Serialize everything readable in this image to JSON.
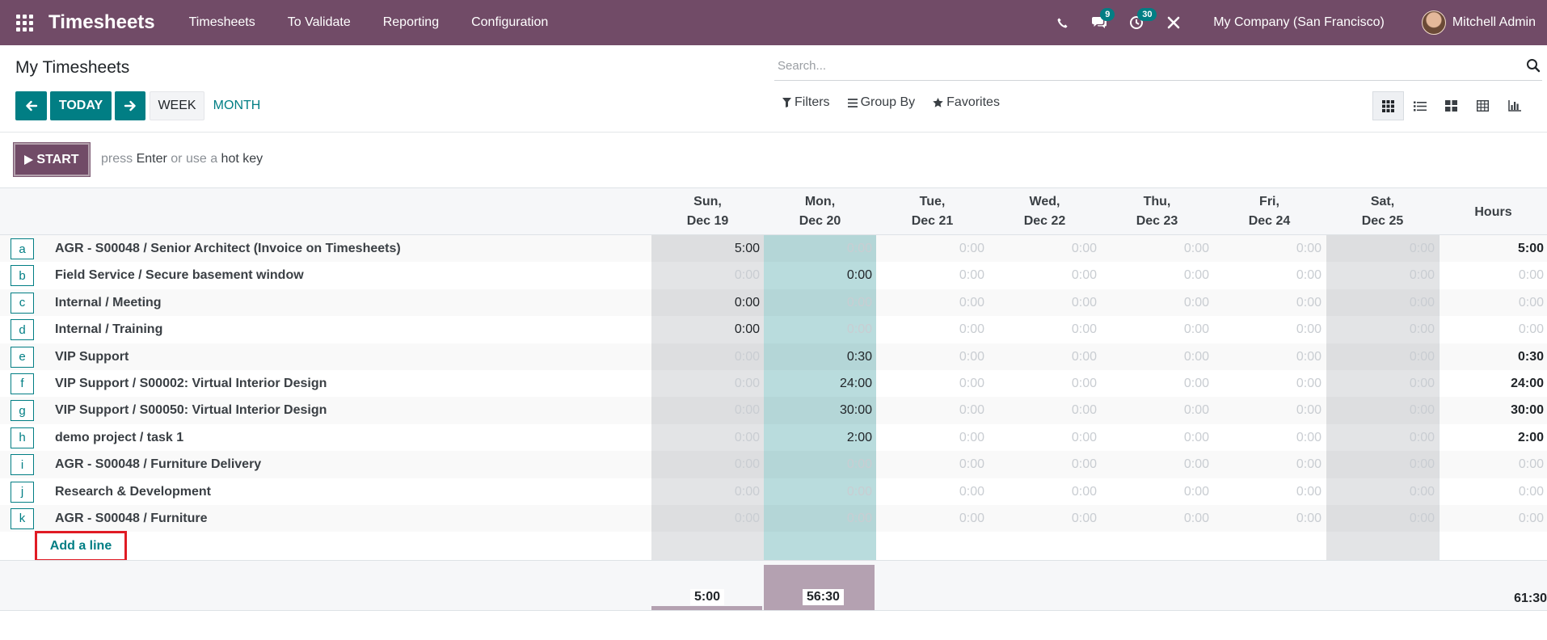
{
  "navbar": {
    "app_name": "Timesheets",
    "menu": [
      "Timesheets",
      "To Validate",
      "Reporting",
      "Configuration"
    ],
    "messages_count": "9",
    "activities_count": "30",
    "company": "My Company (San Francisco)",
    "user": "Mitchell Admin"
  },
  "page": {
    "title": "My Timesheets",
    "search_placeholder": "Search...",
    "today_label": "TODAY",
    "week_label": "WEEK",
    "month_label": "MONTH",
    "filters_label": "Filters",
    "group_by_label": "Group By",
    "favorites_label": "Favorites",
    "start_label": "START",
    "hint_press": "press",
    "hint_enter": "Enter",
    "hint_or": "or use a",
    "hint_hotkey": "hot key"
  },
  "grid": {
    "days": [
      {
        "day": "Sun,",
        "date": "Dec 19"
      },
      {
        "day": "Mon,",
        "date": "Dec 20"
      },
      {
        "day": "Tue,",
        "date": "Dec 21"
      },
      {
        "day": "Wed,",
        "date": "Dec 22"
      },
      {
        "day": "Thu,",
        "date": "Dec 23"
      },
      {
        "day": "Fri,",
        "date": "Dec 24"
      },
      {
        "day": "Sat,",
        "date": "Dec 25"
      }
    ],
    "hours_header": "Hours",
    "rows": [
      {
        "key": "a",
        "name": "AGR - S00048  /  Senior Architect (Invoice on Timesheets)",
        "values": [
          "5:00",
          "0:00",
          "0:00",
          "0:00",
          "0:00",
          "0:00",
          "0:00"
        ],
        "filled": [
          true,
          false,
          false,
          false,
          false,
          false,
          false
        ],
        "total": "5:00"
      },
      {
        "key": "b",
        "name": "Field Service  /  Secure basement window",
        "values": [
          "0:00",
          "0:00",
          "0:00",
          "0:00",
          "0:00",
          "0:00",
          "0:00"
        ],
        "filled": [
          false,
          true,
          false,
          false,
          false,
          false,
          false
        ],
        "total": "0:00"
      },
      {
        "key": "c",
        "name": "Internal  /  Meeting",
        "values": [
          "0:00",
          "0:00",
          "0:00",
          "0:00",
          "0:00",
          "0:00",
          "0:00"
        ],
        "filled": [
          true,
          false,
          false,
          false,
          false,
          false,
          false
        ],
        "total": "0:00"
      },
      {
        "key": "d",
        "name": "Internal  /  Training",
        "values": [
          "0:00",
          "0:00",
          "0:00",
          "0:00",
          "0:00",
          "0:00",
          "0:00"
        ],
        "filled": [
          true,
          false,
          false,
          false,
          false,
          false,
          false
        ],
        "total": "0:00"
      },
      {
        "key": "e",
        "name": "VIP Support",
        "values": [
          "0:00",
          "0:30",
          "0:00",
          "0:00",
          "0:00",
          "0:00",
          "0:00"
        ],
        "filled": [
          false,
          true,
          false,
          false,
          false,
          false,
          false
        ],
        "total": "0:30"
      },
      {
        "key": "f",
        "name": "VIP Support  /  S00002: Virtual Interior Design",
        "values": [
          "0:00",
          "24:00",
          "0:00",
          "0:00",
          "0:00",
          "0:00",
          "0:00"
        ],
        "filled": [
          false,
          true,
          false,
          false,
          false,
          false,
          false
        ],
        "total": "24:00"
      },
      {
        "key": "g",
        "name": "VIP Support  /  S00050: Virtual Interior Design",
        "values": [
          "0:00",
          "30:00",
          "0:00",
          "0:00",
          "0:00",
          "0:00",
          "0:00"
        ],
        "filled": [
          false,
          true,
          false,
          false,
          false,
          false,
          false
        ],
        "total": "30:00"
      },
      {
        "key": "h",
        "name": "demo project  /  task 1",
        "values": [
          "0:00",
          "2:00",
          "0:00",
          "0:00",
          "0:00",
          "0:00",
          "0:00"
        ],
        "filled": [
          false,
          true,
          false,
          false,
          false,
          false,
          false
        ],
        "total": "2:00"
      },
      {
        "key": "i",
        "name": "AGR - S00048  /  Furniture Delivery",
        "values": [
          "0:00",
          "0:00",
          "0:00",
          "0:00",
          "0:00",
          "0:00",
          "0:00"
        ],
        "filled": [
          false,
          false,
          false,
          false,
          false,
          false,
          false
        ],
        "total": "0:00"
      },
      {
        "key": "j",
        "name": "Research & Development",
        "values": [
          "0:00",
          "0:00",
          "0:00",
          "0:00",
          "0:00",
          "0:00",
          "0:00"
        ],
        "filled": [
          false,
          false,
          false,
          false,
          false,
          false,
          false
        ],
        "total": "0:00"
      },
      {
        "key": "k",
        "name": "AGR - S00048  /  Furniture",
        "values": [
          "0:00",
          "0:00",
          "0:00",
          "0:00",
          "0:00",
          "0:00",
          "0:00"
        ],
        "filled": [
          false,
          false,
          false,
          false,
          false,
          false,
          false
        ],
        "total": "0:00"
      }
    ],
    "add_line_label": "Add a line",
    "day_totals": [
      "5:00",
      "56:30",
      "",
      "",
      "",
      "",
      ""
    ],
    "grand_total": "61:30"
  }
}
